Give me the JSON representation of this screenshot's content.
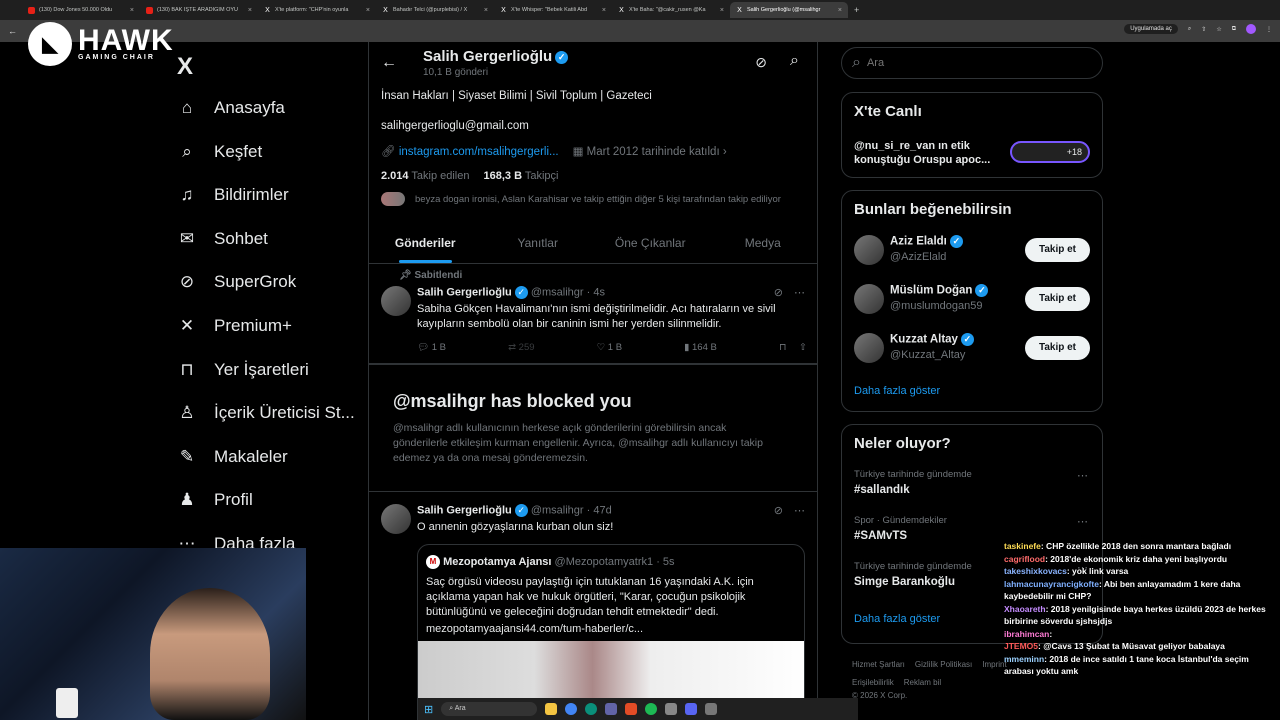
{
  "browser": {
    "tabs": [
      {
        "title": "(130) Dow Jones 50.000 Oldu",
        "kind": "yt"
      },
      {
        "title": "(130) BAK İŞTE ARADIĞIM OYU",
        "kind": "yt"
      },
      {
        "title": "X'te platform: \"CHP'nin oyunla",
        "kind": "x"
      },
      {
        "title": "Bahadır Telci (@purplebisi) / X",
        "kind": "x"
      },
      {
        "title": "X'te Whisper: \"Bebek Katili Abd",
        "kind": "x"
      },
      {
        "title": "X'te Baha: \"@cakir_rusen @Ka",
        "kind": "x"
      },
      {
        "title": "Salih Gergerlioğlu (@msalihgr",
        "kind": "x",
        "active": true
      }
    ],
    "install_label": "Uygulamada aç",
    "tab_close": "×",
    "new_tab": "+"
  },
  "overlay": {
    "brand": "HAWK",
    "brand_sub": "GAMING CHAIR"
  },
  "sidebar": {
    "logo": "X",
    "items": [
      {
        "label": "Anasayfa",
        "icon": "home-icon"
      },
      {
        "label": "Keşfet",
        "icon": "search-icon"
      },
      {
        "label": "Bildirimler",
        "icon": "bell-icon"
      },
      {
        "label": "Sohbet",
        "icon": "mail-icon"
      },
      {
        "label": "SuperGrok",
        "icon": "grok-icon"
      },
      {
        "label": "Premium+",
        "icon": "x-icon"
      },
      {
        "label": "Yer İşaretleri",
        "icon": "bookmark-icon"
      },
      {
        "label": "İçerik Üreticisi St...",
        "icon": "creator-icon"
      },
      {
        "label": "Makaleler",
        "icon": "article-icon"
      },
      {
        "label": "Profil",
        "icon": "person-icon"
      },
      {
        "label": "Daha fazla",
        "icon": "more-icon"
      }
    ]
  },
  "profile": {
    "name": "Salih Gergerlioğlu",
    "posts_count": "10,1 B gönderi",
    "bio": "İnsan Hakları | Siyaset Bilimi | Sivil Toplum | Gazeteci",
    "email": "salihgergerlioglu@gmail.com",
    "link": "instagram.com/msalihgergerli...",
    "joined": "Mart 2012 tarihinde katıldı",
    "following_count": "2.014",
    "following_label": "Takip edilen",
    "followers_count": "168,3 B",
    "followers_label": "Takipçi",
    "followed_by": "beyza dogan ironisi, Aslan Karahisar ve takip ettiğin diğer 5 kişi tarafından takip ediliyor"
  },
  "tabs": [
    {
      "label": "Gönderiler",
      "active": true
    },
    {
      "label": "Yanıtlar"
    },
    {
      "label": "Öne Çıkanlar"
    },
    {
      "label": "Medya"
    }
  ],
  "pinned_post": {
    "pinned_label": "Sabitlendi",
    "author": "Salih Gergerlioğlu",
    "handle": "@msalihgr",
    "time": "· 4s",
    "text": "Sabiha Gökçen Havalimanı'nın ismi değiştirilmelidir. Acı hatıraların ve sivil kayıpların sembolü olan bir caninin ismi her yerden silinmelidir.",
    "replies": "1 B",
    "reposts": "259",
    "likes": "1 B",
    "views": "164 B"
  },
  "blocked": {
    "title": "@msalihgr has blocked you",
    "body": "@msalihgr adlı kullanıcının herkese açık gönderilerini görebilirsin ancak gönderilerle etkileşim kurman engellenir. Ayrıca, @msalihgr adlı kullanıcıyı takip edemez ya da ona mesaj gönderemezsin."
  },
  "post2": {
    "author": "Salih Gergerlioğlu",
    "handle": "@msalihgr",
    "time": "· 47d",
    "text": "O annenin gözyaşlarına kurban olun siz!",
    "quote": {
      "author": "Mezopotamya Ajansı",
      "handle": "@Mezopotamyatrk1",
      "time": "· 5s",
      "text": "Saç örgüsü videosu paylaştığı için tutuklanan 16 yaşındaki A.K. için açıklama yapan hak ve hukuk örgütleri, \"Karar, çocuğun psikolojik bütünlüğünü ve geleceğini doğrudan tehdit etmektedir\" dedi.",
      "link": "mezopotamyaajansi44.com/tum-haberler/c..."
    }
  },
  "right": {
    "search_placeholder": "Ara",
    "live": {
      "title": "X'te Canlı",
      "text": "@nu_si_re_van ın etik konuştuğu Oruspu apoc...",
      "more_count": "+18"
    },
    "suggest": {
      "title": "Bunları beğenebilirsin",
      "users": [
        {
          "name": "Aziz Elaldı",
          "handle": "@AzizElald",
          "button": "Takip et"
        },
        {
          "name": "Müslüm Doğan",
          "handle": "@muslumdogan59",
          "button": "Takip et"
        },
        {
          "name": "Kuzzat Altay",
          "handle": "@Kuzzat_Altay",
          "button": "Takip et"
        }
      ],
      "show_more": "Daha fazla göster"
    },
    "trends": {
      "title": "Neler oluyor?",
      "items": [
        {
          "meta": "Türkiye tarihinde gündemde",
          "name": "#sallandık"
        },
        {
          "meta": "Spor · Gündemdekiler",
          "name": "#SAMvTS"
        },
        {
          "meta": "Türkiye tarihinde gündemde",
          "name": "Simge Barankoğlu"
        }
      ],
      "show_more": "Daha fazla göster"
    },
    "footer": {
      "links": [
        "Hizmet Şartları",
        "Gizlilik Politikası",
        "Imprint",
        "Erişilebilirlik",
        "Reklam bil"
      ],
      "copyright": "© 2026 X Corp."
    }
  },
  "chat": [
    {
      "user": "taskinefe",
      "color": "#ffdd55",
      "text": ": CHP özellikle 2018 den sonra mantara bağladı"
    },
    {
      "user": "cagriflood",
      "color": "#ff6b6b",
      "text": ": 2018'de ekonomik kriz daha yeni başlıyordu"
    },
    {
      "user": "takeshixkovacs",
      "color": "#8ab4ff",
      "text": ": yok link varsa"
    },
    {
      "user": "lahmacunayrancigkofte",
      "color": "#7fb0ff",
      "text": ": Abi ben anlayamadım 1 kere daha kaybedebilir mi CHP?"
    },
    {
      "user": "Xhaoareth",
      "color": "#c58cff",
      "text": ": 2018 yenilgisinde baya herkes üzüldü 2023 de herkes birbirine söverdu sjshsjdjs"
    },
    {
      "user": "ibrahimcan",
      "color": "#ff7bd5",
      "text": ": "
    },
    {
      "user": "JTEMO5",
      "color": "#ff5a5a",
      "text": ": @Cavs 13 Şubat ta Müsavat geliyor babalaya"
    },
    {
      "user": "mmeminn",
      "color": "#9bd1ff",
      "text": ": 2018 de ince satıldı 1 tane koca İstanbul'da seçim arabası yoktu amk"
    }
  ],
  "taskbar": {
    "search_label": "Ara"
  }
}
